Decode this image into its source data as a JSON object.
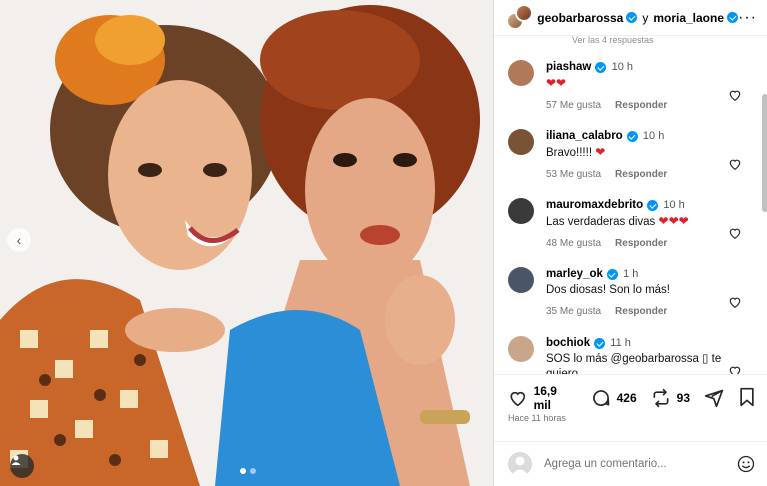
{
  "post": {
    "carousel_dots": 2,
    "active_dot": 1
  },
  "header": {
    "user1": "geobarbarossa",
    "conjunction": "y",
    "user2": "moria_laone",
    "more_icon": "more-icon"
  },
  "replies_cut_text": "Ver las 4 respuestas",
  "comments": [
    {
      "user": "piashaw",
      "verified": true,
      "time": "10 h",
      "text": "",
      "hearts": 2,
      "likes": "57 Me gusta",
      "reply": "Responder",
      "avatar_color": "#b07a5a"
    },
    {
      "user": "iliana_calabro",
      "verified": true,
      "time": "10 h",
      "text": "Bravo!!!!! ",
      "hearts": 1,
      "likes": "53 Me gusta",
      "reply": "Responder",
      "avatar_color": "#7a5236"
    },
    {
      "user": "mauromaxdebrito",
      "verified": true,
      "time": "10 h",
      "text": "Las verdaderas divas ",
      "hearts": 3,
      "likes": "48 Me gusta",
      "reply": "Responder",
      "avatar_color": "#3a3a3a"
    },
    {
      "user": "marley_ok",
      "verified": true,
      "time": "1 h",
      "text": "Dos diosas! Son lo más!",
      "hearts": 0,
      "likes": "35 Me gusta",
      "reply": "Responder",
      "avatar_color": "#4a5568"
    },
    {
      "user": "bochiok",
      "verified": true,
      "time": "11 h",
      "text": "SOS lo más @geobarbarossa ▯ te quiero",
      "hearts": 0,
      "likes": "",
      "reply": "",
      "avatar_color": "#c9a58a"
    }
  ],
  "actions": {
    "likes": "16,9 mil",
    "comments": "426",
    "reposts": "93"
  },
  "posted_time": "Hace 11 horas",
  "add_comment": {
    "placeholder": "Agrega un comentario..."
  },
  "colors": {
    "verified": "#0095f6",
    "heart": "#e0202c"
  }
}
